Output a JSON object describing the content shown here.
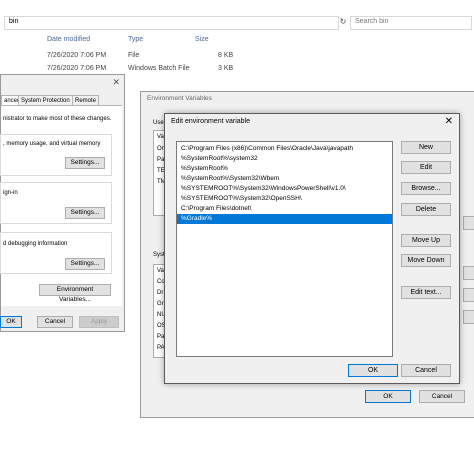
{
  "explorer": {
    "address": "bin",
    "search_placeholder": "Search bin",
    "refresh_icon": "refresh-icon",
    "columns": [
      "Date modified",
      "Type",
      "Size"
    ],
    "files": [
      {
        "date": "7/26/2020 7:06 PM",
        "type": "File",
        "size": "8 KB"
      },
      {
        "date": "7/26/2020 7:06 PM",
        "type": "Windows Batch File",
        "size": "3 KB"
      }
    ]
  },
  "system_properties": {
    "tabs": [
      "anced",
      "System Protection",
      "Remote"
    ],
    "admin_text": "nistrator to make most of these changes.",
    "perf_text": ", memory usage, and virtual memory",
    "signin_text": "ign-in",
    "debug_text": "d debugging information",
    "settings_label": "Settings...",
    "env_button": "Environment Variables...",
    "ok": "OK",
    "cancel": "Cancel",
    "apply": "Apply"
  },
  "environment_variables": {
    "title": "Environment Variables",
    "user_group_label": "Use",
    "user_rows": [
      "Va",
      "On",
      "Pa",
      "TE",
      "TM"
    ],
    "system_group_label": "Syst",
    "system_rows": [
      "Va",
      "Co",
      "Dr",
      "Gr",
      "NU",
      "OS",
      "Pa",
      "PA"
    ],
    "ok": "OK",
    "cancel": "Cancel"
  },
  "edit_dialog": {
    "title": "Edit environment variable",
    "paths": [
      "C:\\Program Files (x86)\\Common Files\\Oracle\\Java\\javapath",
      "%SystemRoot%\\system32",
      "%SystemRoot%",
      "%SystemRoot%\\System32\\Wbem",
      "%SYSTEMROOT%\\System32\\WindowsPowerShell\\v1.0\\",
      "%SYSTEMROOT%\\System32\\OpenSSH\\",
      "C:\\Program Files\\dotnet\\",
      "%Gradle%"
    ],
    "selected_index": 7,
    "buttons": {
      "new": "New",
      "edit": "Edit",
      "browse": "Browse...",
      "delete": "Delete",
      "move_up": "Move Up",
      "move_down": "Move Down",
      "edit_text": "Edit text...",
      "ok": "OK",
      "cancel": "Cancel"
    }
  },
  "colors": {
    "selection": "#0078d7",
    "dialog_bg": "#f0f0f0",
    "button_bg": "#e1e1e1"
  }
}
